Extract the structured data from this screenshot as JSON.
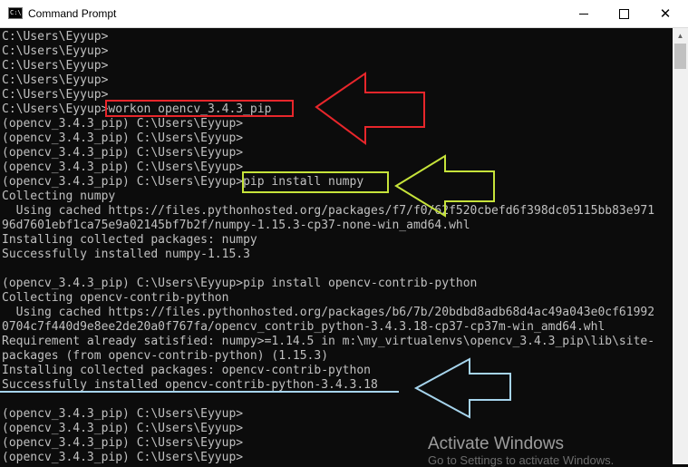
{
  "window": {
    "title": "Command Prompt",
    "icon_text": "C:\\",
    "minimize_glyph": "–",
    "close_glyph": "✕"
  },
  "console": {
    "lines": [
      "C:\\Users\\Eyyup>",
      "C:\\Users\\Eyyup>",
      "C:\\Users\\Eyyup>",
      "C:\\Users\\Eyyup>",
      "C:\\Users\\Eyyup>",
      "C:\\Users\\Eyyup>workon opencv_3.4.3_pip",
      "(opencv_3.4.3_pip) C:\\Users\\Eyyup>",
      "(opencv_3.4.3_pip) C:\\Users\\Eyyup>",
      "(opencv_3.4.3_pip) C:\\Users\\Eyyup>",
      "(opencv_3.4.3_pip) C:\\Users\\Eyyup>",
      "(opencv_3.4.3_pip) C:\\Users\\Eyyup>pip install numpy",
      "Collecting numpy",
      "  Using cached https://files.pythonhosted.org/packages/f7/f0/62f520cbefd6f398dc05115bb83e971",
      "96d7601ebf1ca75e9a02145bf7b2f/numpy-1.15.3-cp37-none-win_amd64.whl",
      "Installing collected packages: numpy",
      "Successfully installed numpy-1.15.3",
      "",
      "(opencv_3.4.3_pip) C:\\Users\\Eyyup>pip install opencv-contrib-python",
      "Collecting opencv-contrib-python",
      "  Using cached https://files.pythonhosted.org/packages/b6/7b/20bdbd8adb68d4ac49a043e0cf61992",
      "0704c7f440d9e8ee2de20a0f767fa/opencv_contrib_python-3.4.3.18-cp37-cp37m-win_amd64.whl",
      "Requirement already satisfied: numpy>=1.14.5 in m:\\my_virtualenvs\\opencv_3.4.3_pip\\lib\\site-",
      "packages (from opencv-contrib-python) (1.15.3)",
      "Installing collected packages: opencv-contrib-python",
      "Successfully installed opencv-contrib-python-3.4.3.18",
      "",
      "(opencv_3.4.3_pip) C:\\Users\\Eyyup>",
      "(opencv_3.4.3_pip) C:\\Users\\Eyyup>",
      "(opencv_3.4.3_pip) C:\\Users\\Eyyup>",
      "(opencv_3.4.3_pip) C:\\Users\\Eyyup>"
    ]
  },
  "annotations": {
    "red": "#e8262b",
    "yellow_green": "#c6e33a",
    "light_blue": "#a6d4ec"
  },
  "watermark": {
    "title": "Activate Windows",
    "subtitle": "Go to Settings to activate Windows."
  }
}
